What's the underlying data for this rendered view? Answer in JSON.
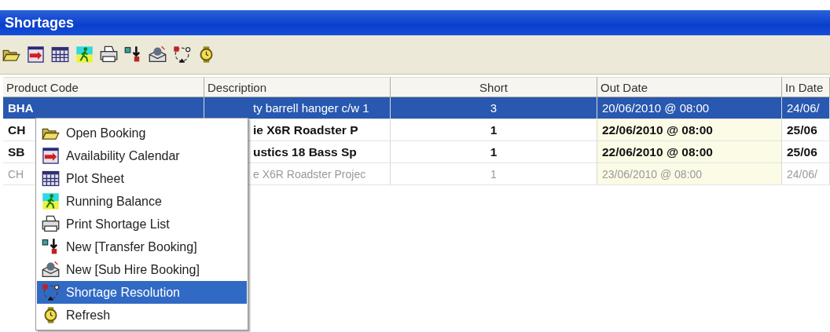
{
  "window": {
    "title": "Shortages"
  },
  "table": {
    "columns": [
      {
        "label": "Product Code"
      },
      {
        "label": "Description"
      },
      {
        "label": "Short"
      },
      {
        "label": "Out Date"
      },
      {
        "label": "In Date"
      }
    ],
    "rows": [
      {
        "cells": [
          "BHA",
          "ty barrell hanger c/w 1",
          "3",
          "20/06/2010 @ 08:00",
          "24/06/"
        ],
        "selected": true,
        "bold": false,
        "greyed": false
      },
      {
        "cells": [
          "CH",
          "ie X6R Roadster P",
          "1",
          "22/06/2010 @ 08:00",
          "25/06"
        ],
        "selected": false,
        "bold": true,
        "greyed": false
      },
      {
        "cells": [
          "SB",
          "ustics 18  Bass Sp",
          "1",
          "22/06/2010 @ 08:00",
          "25/06"
        ],
        "selected": false,
        "bold": true,
        "greyed": false
      },
      {
        "cells": [
          "CH",
          "e X6R Roadster Projec",
          "1",
          "23/06/2010 @ 08:00",
          "24/06/"
        ],
        "selected": false,
        "bold": false,
        "greyed": true
      }
    ]
  },
  "context_menu": {
    "items": [
      {
        "label": "Open Booking",
        "selected": false
      },
      {
        "label": "Availability Calendar",
        "selected": false
      },
      {
        "label": "Plot Sheet",
        "selected": false
      },
      {
        "label": "Running Balance",
        "selected": false
      },
      {
        "label": "Print Shortage List",
        "selected": false
      },
      {
        "label": "New [Transfer Booking]",
        "selected": false
      },
      {
        "label": "New [Sub Hire Booking]",
        "selected": false
      },
      {
        "label": "Shortage Resolution",
        "selected": true
      },
      {
        "label": "Refresh",
        "selected": false
      }
    ]
  }
}
